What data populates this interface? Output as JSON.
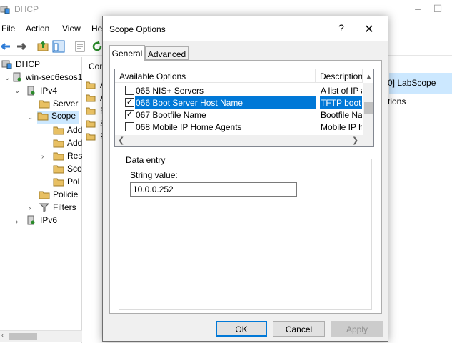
{
  "app": {
    "title": "DHCP",
    "menu": [
      "File",
      "Action",
      "View",
      "He"
    ]
  },
  "tree": {
    "items": [
      {
        "label": "DHCP",
        "icon": "dhcp-root-icon"
      },
      {
        "label": "win-sec6esos1",
        "icon": "server-icon"
      },
      {
        "label": "IPv4",
        "icon": "ipv4-icon"
      },
      {
        "label": "Server",
        "icon": "folder-icon"
      },
      {
        "label": "Scope",
        "icon": "folder-icon"
      },
      {
        "label": "Add",
        "icon": "folder-icon"
      },
      {
        "label": "Add",
        "icon": "folder-icon"
      },
      {
        "label": "Res",
        "icon": "folder-icon"
      },
      {
        "label": "Sco",
        "icon": "folder-icon"
      },
      {
        "label": "Pol",
        "icon": "folder-icon"
      },
      {
        "label": "Policie",
        "icon": "folder-icon"
      },
      {
        "label": "Filters",
        "icon": "filter-icon"
      },
      {
        "label": "IPv6",
        "icon": "ipv6-icon"
      }
    ]
  },
  "right_pane": {
    "header": "Con",
    "rows": [
      "A",
      "A",
      "R",
      "S",
      "P"
    ],
    "scope_title": "0] LabScope",
    "scope_sub": "tions"
  },
  "dialog": {
    "title": "Scope Options",
    "help": "?",
    "close": "✕",
    "tabs": [
      "General",
      "Advanced"
    ],
    "list": {
      "col_option": "Available Options",
      "col_desc": "Description",
      "rows": [
        {
          "checked": false,
          "name": "065 NIS+ Servers",
          "desc": "A list of IP a",
          "selected": false
        },
        {
          "checked": true,
          "name": "066 Boot Server Host Name",
          "desc": "TFTP boot s",
          "selected": true
        },
        {
          "checked": true,
          "name": "067 Bootfile Name",
          "desc": "Bootfile Nam",
          "selected": false
        },
        {
          "checked": false,
          "name": "068 Mobile IP Home Agents",
          "desc": "Mobile IP ho",
          "selected": false
        }
      ]
    },
    "data_entry": {
      "legend": "Data entry",
      "string_label": "String value:",
      "string_value": "10.0.0.252"
    },
    "buttons": {
      "ok": "OK",
      "cancel": "Cancel",
      "apply": "Apply"
    }
  },
  "colors": {
    "selection": "#0078d7",
    "folder": "#e8c063",
    "button_face": "#e1e1e1"
  }
}
